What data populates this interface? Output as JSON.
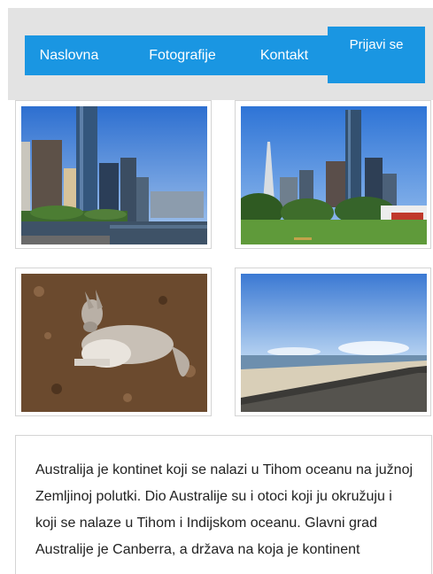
{
  "nav": {
    "items": [
      {
        "label": "Naslovna"
      },
      {
        "label": "Fotografije"
      },
      {
        "label": "Kontakt"
      },
      {
        "label": "Prijavi se"
      }
    ]
  },
  "gallery": {
    "photos": [
      {
        "subject": "Melbourne skyline across the Yarra river"
      },
      {
        "subject": "Melbourne skyline over a park"
      },
      {
        "subject": "Kangaroo resting on wood chips"
      },
      {
        "subject": "Beach with seawall"
      }
    ]
  },
  "article": {
    "text": "Australija je kontinet koji se nalazi u Tihom oceanu na južnoj Zemljinoj polutki. Dio Australije su i otoci koji ju okružuju i koji se nalaze u Tihom i Indijskom oceanu. Glavni grad Australije je Canberra, a država na koja je kontinent"
  },
  "colors": {
    "nav_background": "#1a96e2",
    "header_band": "#e3e3e3",
    "text": "#222222"
  }
}
